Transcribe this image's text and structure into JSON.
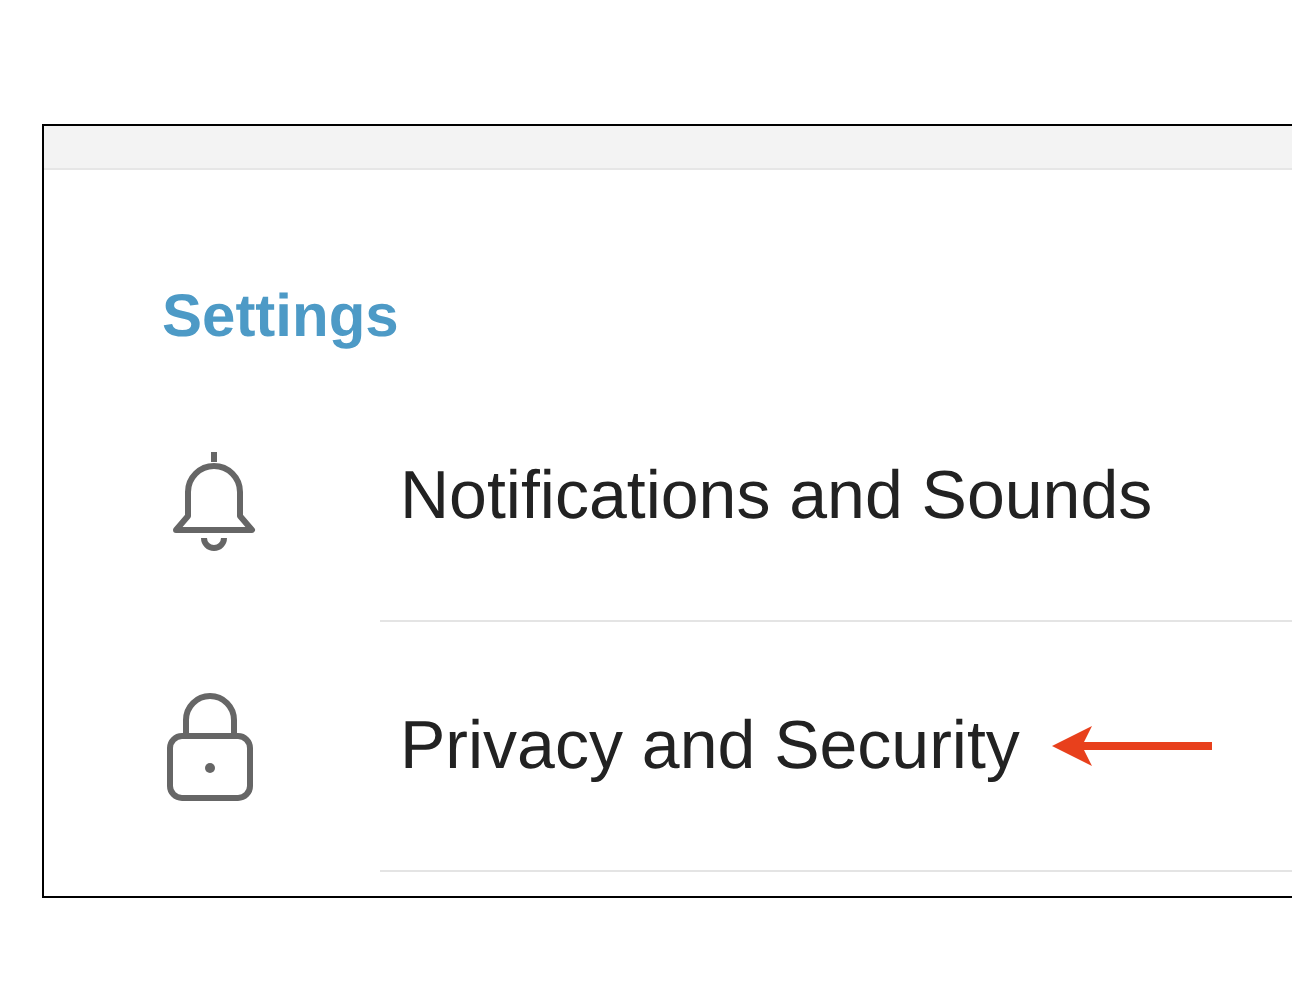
{
  "section_title": "Settings",
  "items": [
    {
      "kind": "bell",
      "label": "Notifications and Sounds"
    },
    {
      "kind": "lock",
      "label": "Privacy and Security"
    }
  ]
}
